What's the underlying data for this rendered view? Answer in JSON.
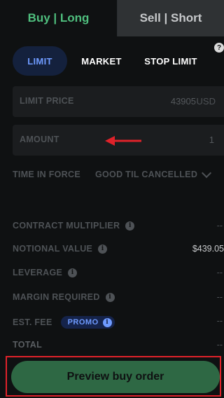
{
  "tabs": {
    "buy": "Buy | Long",
    "sell": "Sell | Short"
  },
  "order_types": {
    "limit": "LIMIT",
    "market": "MARKET",
    "stop_limit": "STOP LIMIT"
  },
  "help_icon": "?",
  "limit_price": {
    "label": "LIMIT PRICE",
    "value": "43905",
    "unit": "USD"
  },
  "amount": {
    "label": "AMOUNT",
    "value": "1"
  },
  "time_in_force": {
    "label": "TIME IN FORCE",
    "value": "GOOD TIL CANCELLED"
  },
  "summary": {
    "contract_multiplier": {
      "label": "CONTRACT MULTIPLIER",
      "value": "--"
    },
    "notional_value": {
      "label": "NOTIONAL VALUE",
      "value": "$439.05"
    },
    "leverage": {
      "label": "LEVERAGE",
      "value": "--"
    },
    "margin_required": {
      "label": "MARGIN REQUIRED",
      "value": "--"
    },
    "est_fee": {
      "label": "EST. FEE",
      "promo": "PROMO",
      "value": "--"
    },
    "total": {
      "label": "TOTAL",
      "value": "--"
    }
  },
  "cta": {
    "label": "Preview buy order"
  },
  "colors": {
    "buy_green": "#4fbf7e",
    "accent_blue": "#6f9bff",
    "highlight_red": "#e0222a"
  }
}
